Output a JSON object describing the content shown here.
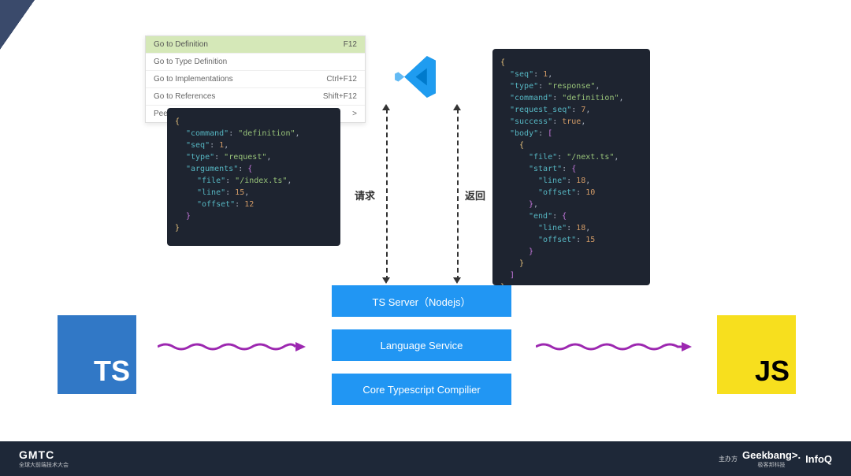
{
  "contextMenu": {
    "items": [
      {
        "label": "Go to Definition",
        "shortcut": "F12",
        "selected": true
      },
      {
        "label": "Go to Type Definition",
        "shortcut": ""
      },
      {
        "label": "Go to Implementations",
        "shortcut": "Ctrl+F12"
      },
      {
        "label": "Go to References",
        "shortcut": "Shift+F12"
      },
      {
        "label": "Peek",
        "shortcut": ">"
      }
    ]
  },
  "labels": {
    "request": "请求",
    "response": "返回"
  },
  "boxes": {
    "tsserver": "TS Server（Nodejs）",
    "langservice": "Language Service",
    "compiler": "Core Typescript Compilier"
  },
  "logos": {
    "ts": "TS",
    "js": "JS"
  },
  "requestJson": {
    "command": "definition",
    "seq": 1,
    "type": "request",
    "arguments": {
      "file": "/index.ts",
      "line": 15,
      "offset": 12
    }
  },
  "responseJson": {
    "seq": 1,
    "type": "response",
    "command": "definition",
    "request_seq": 7,
    "success": true,
    "body": [
      {
        "file": "/next.ts",
        "start": {
          "line": 18,
          "offset": 10
        },
        "end": {
          "line": 18,
          "offset": 15
        }
      }
    ]
  },
  "footer": {
    "leftMain": "GMTC",
    "leftSub": "全球大前端技术大会",
    "hostLabel": "主办方",
    "brand1": "Geekbang>.",
    "brand1Sub": "极客邦科技",
    "brand2": "InfoQ"
  }
}
